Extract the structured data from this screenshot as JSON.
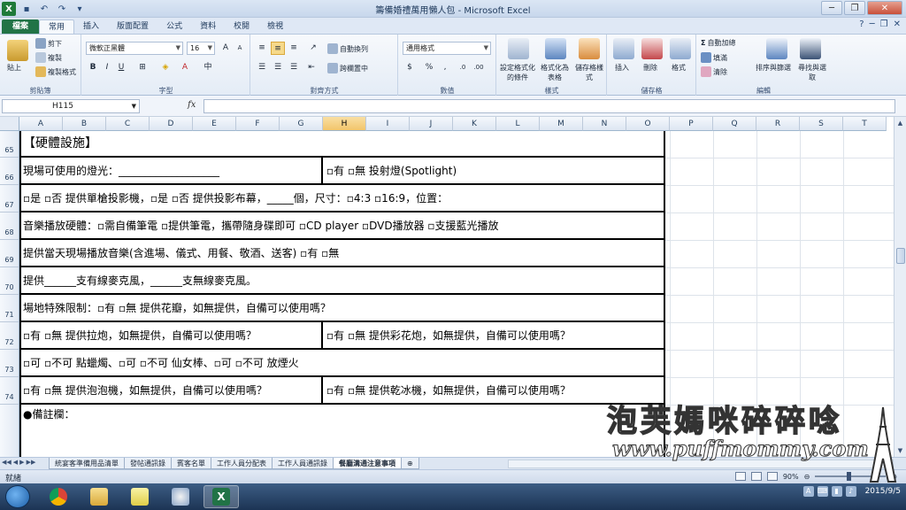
{
  "window": {
    "title": "籌備婚禮萬用懶人包 - Microsoft Excel",
    "app_icon": "excel-icon",
    "qat_icons": [
      "save-icon",
      "undo-icon",
      "redo-icon",
      "open-icon"
    ],
    "controls": [
      "─",
      "❐",
      "✕"
    ]
  },
  "ribbon_tabs": [
    "檔案",
    "常用",
    "插入",
    "版面配置",
    "公式",
    "資料",
    "校閱",
    "檢視"
  ],
  "active_tab": "常用",
  "ribbon": {
    "clipboard": {
      "paste": "貼上",
      "cut": "剪下",
      "copy": "複製",
      "format_painter": "複製格式",
      "label": "剪貼簿"
    },
    "font": {
      "name": "微軟正黑體",
      "size": "16",
      "bold": "B",
      "italic": "I",
      "underline": "U",
      "label": "字型"
    },
    "alignment": {
      "wrap": "自動換列",
      "merge": "跨欄置中",
      "label": "對齊方式"
    },
    "number": {
      "format": "通用格式",
      "currency": "$",
      "percent": "%",
      "comma": ",",
      "label": "數值"
    },
    "styles": {
      "conditional": "設定格式化的條件",
      "table": "格式化為表格",
      "cell": "儲存格樣式",
      "label": "樣式"
    },
    "cells": {
      "insert": "插入",
      "delete": "刪除",
      "format": "格式",
      "label": "儲存格"
    },
    "editing": {
      "autosum": "自動加總",
      "fill": "填滿",
      "clear": "清除",
      "sort": "排序與篩選",
      "find": "尋找與選取",
      "label": "編輯"
    }
  },
  "formula_bar": {
    "cell_ref": "H115",
    "fx": "fx",
    "formula": ""
  },
  "columns": [
    "A",
    "B",
    "C",
    "D",
    "E",
    "F",
    "G",
    "H",
    "I",
    "J",
    "K",
    "L",
    "M",
    "N",
    "O",
    "P",
    "Q",
    "R",
    "S",
    "T"
  ],
  "selected_column": "H",
  "rows": [
    "65",
    "66",
    "67",
    "68",
    "69",
    "70",
    "71",
    "72",
    "73",
    "74"
  ],
  "form": {
    "title": "【硬體設施】",
    "lighting_left": "現場可使用的燈光：___________________",
    "lighting_right": "▫有 ▫無 投射燈(Spotlight)",
    "projector": "▫是 ▫否 提供單槍投影機，▫是 ▫否 提供投影布幕，_____個，尺寸：▫4:3 ▫16:9，位置：",
    "audio": "音樂播放硬體：▫需自備筆電 ▫提供筆電，攜帶隨身碟即可 ▫CD player ▫DVD播放器 ▫支援藍光播放",
    "music": "提供當天現場播放音樂(含進場、儀式、用餐、敬酒、送客) ▫有 ▫無",
    "mic": "提供______支有線麥克風，______支無線麥克風。",
    "restriction": "場地特殊限制：▫有 ▫無 提供花瓣，如無提供，自備可以使用嗎？",
    "popper_left": "▫有 ▫無 提供拉炮，如無提供，自備可以使用嗎？",
    "popper_right": "▫有 ▫無 提供彩花炮，如無提供，自備可以使用嗎？",
    "fire": "▫可 ▫不可 點蠟燭、▫可 ▫不可 仙女棒、▫可 ▫不可 放煙火",
    "bubble_left": "▫有 ▫無 提供泡泡機，如無提供，自備可以使用嗎？",
    "bubble_right": "▫有 ▫無 提供乾冰機，如無提供，自備可以使用嗎？",
    "notes": "●備註欄："
  },
  "sheet_tabs": [
    "統宴客準備用品清單",
    "發帖通訊錄",
    "賓客名單",
    "工作人員分配表",
    "工作人員通訊錄",
    "餐廳溝通注意事項"
  ],
  "active_sheet": "餐廳溝通注意事項",
  "status": {
    "text": "就緒",
    "zoom": "90%"
  },
  "taskbar": {
    "items": [
      "start-orb",
      "chrome-icon",
      "folder-icon",
      "notes-icon",
      "paint-icon",
      "excel-icon"
    ],
    "date": "2015/9/5"
  },
  "watermark": {
    "title": "泡芙媽咪碎碎唸",
    "url": "www.puffmommy.com"
  },
  "colors": {
    "excel_green": "#217346",
    "selection": "#f2c56b"
  }
}
